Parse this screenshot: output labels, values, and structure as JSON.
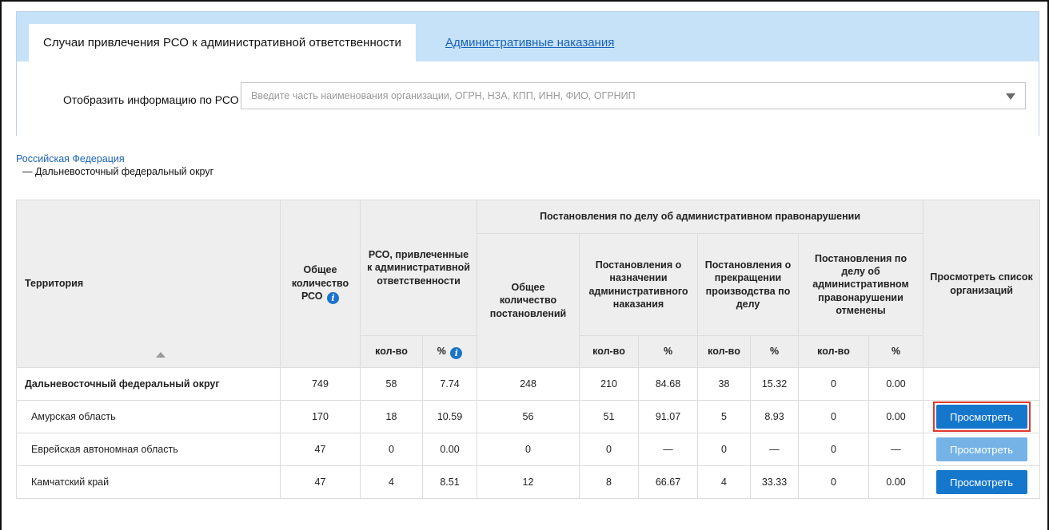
{
  "tabs": {
    "active": "Случаи привлечения РСО к административной ответственности",
    "link": "Административные наказания"
  },
  "filter": {
    "label": "Отобразить информацию по РСО",
    "placeholder": "Введите часть наименования организации, ОГРН, НЗА, КПП, ИНН, ФИО, ОГРНИП",
    "value": ""
  },
  "breadcrumb": {
    "root": "Российская Федерация",
    "current": "— Дальневосточный федеральный округ"
  },
  "table": {
    "headers": {
      "territory": "Территория",
      "total_rso": "Общее количество РСО",
      "rso_liable": "РСО, привлеченные к административной ответственности",
      "resolutions_group": "Постановления по делу об административном правонарушении",
      "total_resolutions": "Общее количество постановлений",
      "res_penalty": "Постановления о назначении административного наказания",
      "res_terminated": "Постановления о прекращении производства по делу",
      "res_cancelled": "Постановления по делу об административном правонарушении отменены",
      "view_list": "Просмотреть список организаций",
      "count": "кол-во",
      "percent": "%"
    },
    "rows": [
      {
        "name": "Дальневосточный федеральный округ",
        "total": "749",
        "liable_count": "58",
        "liable_pct": "7.74",
        "total_res": "248",
        "penalty_count": "210",
        "penalty_pct": "84.68",
        "term_count": "38",
        "term_pct": "15.32",
        "cancel_count": "0",
        "cancel_pct": "0.00",
        "button": ""
      },
      {
        "name": "Амурская область",
        "total": "170",
        "liable_count": "18",
        "liable_pct": "10.59",
        "total_res": "56",
        "penalty_count": "51",
        "penalty_pct": "91.07",
        "term_count": "5",
        "term_pct": "8.93",
        "cancel_count": "0",
        "cancel_pct": "0.00",
        "button": "Просмотреть"
      },
      {
        "name": "Еврейская автономная область",
        "total": "47",
        "liable_count": "0",
        "liable_pct": "0.00",
        "total_res": "0",
        "penalty_count": "0",
        "penalty_pct": "—",
        "term_count": "0",
        "term_pct": "—",
        "cancel_count": "0",
        "cancel_pct": "—",
        "button": "Просмотреть"
      },
      {
        "name": "Камчатский край",
        "total": "47",
        "liable_count": "4",
        "liable_pct": "8.51",
        "total_res": "12",
        "penalty_count": "8",
        "penalty_pct": "66.67",
        "term_count": "4",
        "term_pct": "33.33",
        "cancel_count": "0",
        "cancel_pct": "0.00",
        "button": "Просмотреть"
      }
    ]
  },
  "colors": {
    "tab_strip": "#c6e2f8",
    "link": "#1a63b8",
    "button": "#1577cc",
    "button_disabled": "#75b3e6",
    "highlight": "#e03a2c",
    "header_bg": "#eeeeee"
  },
  "icons": [
    "info-icon",
    "sort-up-icon",
    "dropdown-arrow-icon"
  ]
}
